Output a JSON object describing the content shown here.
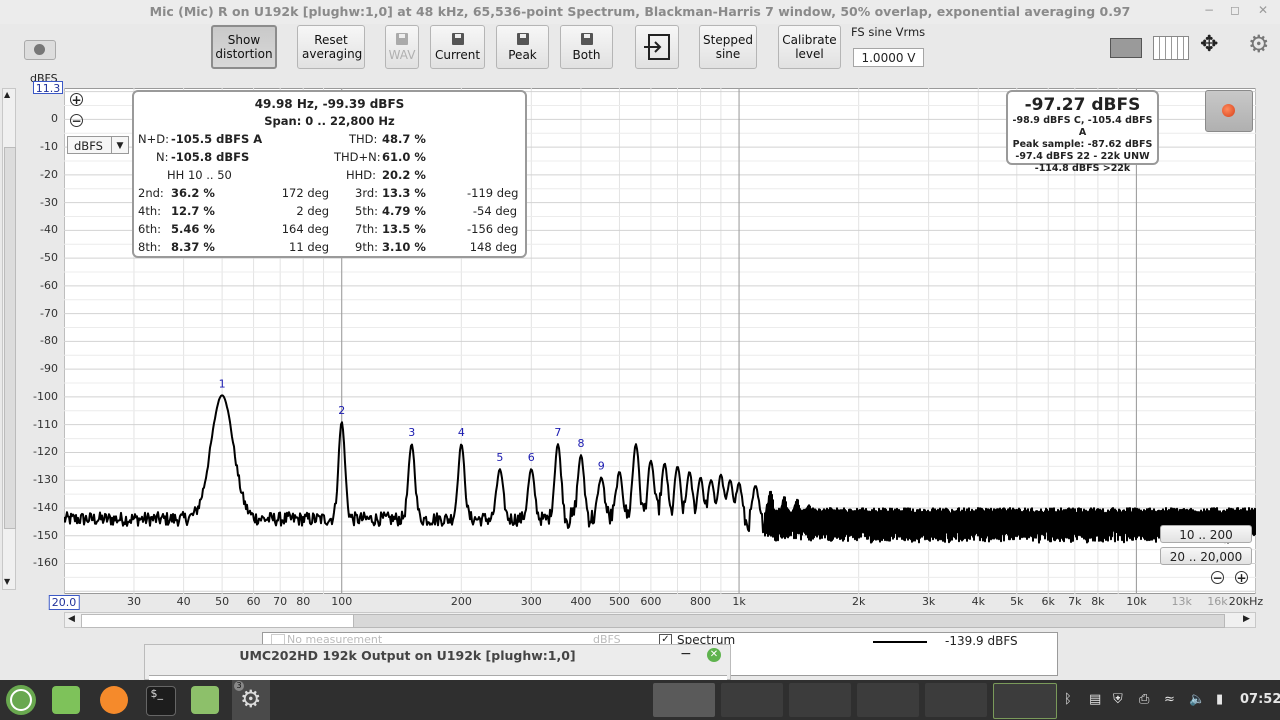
{
  "window": {
    "title": "Mic (Mic) R on U192k [plughw:1,0] at 48 kHz, 65,536-point Spectrum, Blackman-Harris 7 window, 50% overlap, exponential averaging 0.97"
  },
  "toolbar": {
    "show_distortion": "Show distortion",
    "reset_averaging": "Reset averaging",
    "wav": "WAV",
    "current": "Current",
    "peak": "Peak",
    "both": "Both",
    "stepped_sine": "Stepped sine",
    "calibrate_level": "Calibrate level",
    "fs_label": "FS sine Vrms",
    "fs_value": "1.0000 V"
  },
  "yaxis": {
    "unit_label": "dBFS",
    "top_value": "11.3",
    "unit_select": "dBFS",
    "ticks": [
      "0",
      "-10",
      "-20",
      "-30",
      "-40",
      "-50",
      "-60",
      "-70",
      "-80",
      "-90",
      "-100",
      "-110",
      "-120",
      "-130",
      "-140",
      "-150",
      "-160"
    ]
  },
  "xaxis": {
    "ticks": [
      "20.0",
      "30",
      "40",
      "50",
      "60",
      "70",
      "80",
      "100",
      "200",
      "300",
      "400",
      "500",
      "600",
      "800",
      "1k",
      "2k",
      "3k",
      "4k",
      "5k",
      "6k",
      "7k",
      "8k",
      "10k",
      "13k",
      "16k",
      "20kHz"
    ]
  },
  "readout": {
    "line1": "49.98 Hz, -99.39 dBFS",
    "span": "Span: 0 .. 22,800 Hz",
    "nd_label": "N+D:",
    "nd_value": "-105.5 dBFS A",
    "thd_label": "THD:",
    "thd_value": "48.7 %",
    "n_label": "N:",
    "n_value": "-105.8 dBFS",
    "thdn_label": "THD+N:",
    "thdn_value": "61.0 %",
    "hh_label": "HH 10 .. 50",
    "hhd_label": "HHD:",
    "hhd_value": "20.2 %",
    "harmonics": [
      {
        "left_label": "2nd:",
        "left_value": "36.2 %",
        "left_deg": "172 deg",
        "right_label": "3rd:",
        "right_value": "13.3 %",
        "right_deg": "-119 deg"
      },
      {
        "left_label": "4th:",
        "left_value": "12.7 %",
        "left_deg": "2 deg",
        "right_label": "5th:",
        "right_value": "4.79 %",
        "right_deg": "-54 deg"
      },
      {
        "left_label": "6th:",
        "left_value": "5.46 %",
        "left_deg": "164 deg",
        "right_label": "7th:",
        "right_value": "13.5 %",
        "right_deg": "-156 deg"
      },
      {
        "left_label": "8th:",
        "left_value": "8.37 %",
        "left_deg": "11 deg",
        "right_label": "9th:",
        "right_value": "3.10 %",
        "right_deg": "148 deg"
      }
    ]
  },
  "level": {
    "main": "-97.27 dBFS",
    "line1": "-98.9 dBFS C, -105.4 dBFS A",
    "line2": "Peak sample: -87.62 dBFS",
    "line3": "-97.4 dBFS 22 - 22k UNW",
    "line4": "-114.8 dBFS >22k"
  },
  "range_buttons": {
    "low": "10 .. 200",
    "high": "20 .. 20,000"
  },
  "chart_data": {
    "type": "line",
    "xlabel": "",
    "ylabel": "dBFS",
    "xscale": "log",
    "xlim": [
      20,
      20000
    ],
    "ylim": [
      -171,
      11.3
    ],
    "noise_floor_db": -142,
    "harmonic_labels": [
      "1",
      "2",
      "3",
      "4",
      "5",
      "6",
      "7",
      "8",
      "9"
    ],
    "peaks": [
      {
        "freq": 50,
        "db": -99.4
      },
      {
        "freq": 100,
        "db": -109
      },
      {
        "freq": 150,
        "db": -117
      },
      {
        "freq": 200,
        "db": -117
      },
      {
        "freq": 250,
        "db": -126
      },
      {
        "freq": 300,
        "db": -126
      },
      {
        "freq": 350,
        "db": -117
      },
      {
        "freq": 400,
        "db": -121
      },
      {
        "freq": 450,
        "db": -129
      },
      {
        "freq": 500,
        "db": -127
      },
      {
        "freq": 550,
        "db": -117
      },
      {
        "freq": 600,
        "db": -123
      },
      {
        "freq": 650,
        "db": -124
      },
      {
        "freq": 700,
        "db": -125
      },
      {
        "freq": 750,
        "db": -127
      },
      {
        "freq": 800,
        "db": -129
      },
      {
        "freq": 850,
        "db": -130
      },
      {
        "freq": 900,
        "db": -128
      },
      {
        "freq": 950,
        "db": -130
      },
      {
        "freq": 1000,
        "db": -131
      },
      {
        "freq": 1100,
        "db": -132
      },
      {
        "freq": 1200,
        "db": -134
      },
      {
        "freq": 1300,
        "db": -136
      },
      {
        "freq": 1400,
        "db": -137
      },
      {
        "freq": 1500,
        "db": -139
      }
    ]
  },
  "bottom": {
    "legend_level": "-139.9 dBFS",
    "legend_spectrum": "Spectrum",
    "legend_hidden": "No measurement",
    "legend_hidden_unit": "dBFS",
    "second_window_title": "UMC202HD 192k Output on U192k [plughw:1,0]"
  },
  "taskbar": {
    "clock": "07:52",
    "badge": "3"
  }
}
